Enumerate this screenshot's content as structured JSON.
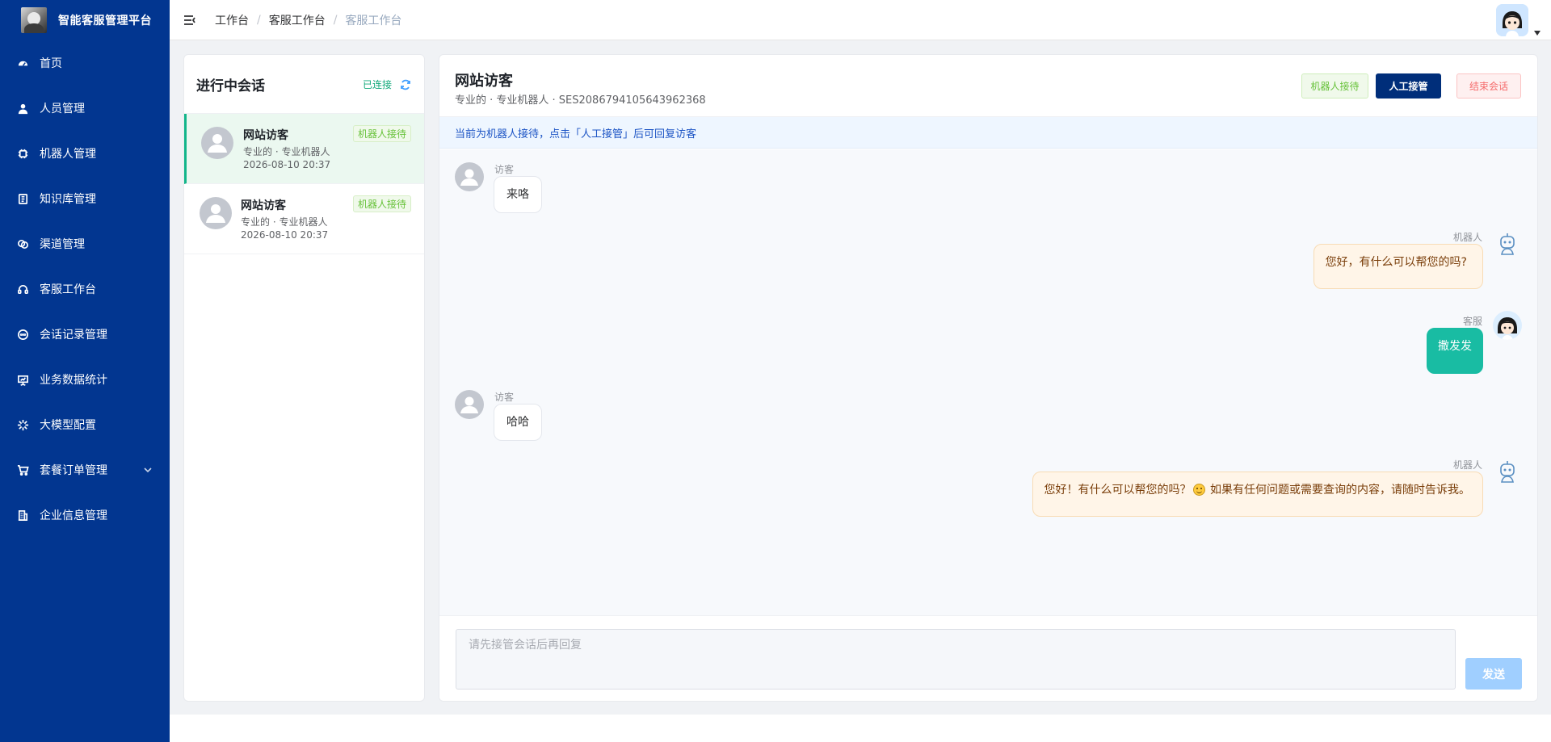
{
  "brand": {
    "title": "智能客服管理平台"
  },
  "sidebar": {
    "items": [
      {
        "label": "首页",
        "icon": "dashboard-icon"
      },
      {
        "label": "人员管理",
        "icon": "user-icon"
      },
      {
        "label": "机器人管理",
        "icon": "chip-icon"
      },
      {
        "label": "知识库管理",
        "icon": "book-icon"
      },
      {
        "label": "渠道管理",
        "icon": "link-icon"
      },
      {
        "label": "客服工作台",
        "icon": "headset-icon"
      },
      {
        "label": "会话记录管理",
        "icon": "chat-bubble-icon"
      },
      {
        "label": "业务数据统计",
        "icon": "presentation-chart-icon"
      },
      {
        "label": "大模型配置",
        "icon": "sparkle-icon"
      },
      {
        "label": "套餐订单管理",
        "icon": "cart-icon",
        "has_children": true
      },
      {
        "label": "企业信息管理",
        "icon": "building-icon"
      }
    ]
  },
  "header": {
    "breadcrumb": [
      "工作台",
      "客服工作台",
      "客服工作台"
    ]
  },
  "sessions": {
    "title": "进行中会话",
    "status": "已连接",
    "items": [
      {
        "name": "网站访客",
        "meta": "专业的 · 专业机器人",
        "time": "2026-08-10 20:37",
        "tag": "机器人接待",
        "active": true
      },
      {
        "name": "网站访客",
        "meta": "专业的 · 专业机器人",
        "time": "2026-08-10 20:37",
        "tag": "机器人接待",
        "active": false
      }
    ]
  },
  "chat": {
    "title": "网站访客",
    "subtitle": "专业的 · 专业机器人 · SES2086794105643962368",
    "buttons": {
      "robot": "机器人接待",
      "takeover": "人工接管",
      "end": "结束会话"
    },
    "notice": "当前为机器人接待，点击「人工接管」后可回复访客",
    "messages": [
      {
        "role": "visitor",
        "label": "访客",
        "text": "来咯"
      },
      {
        "role": "robot",
        "label": "机器人",
        "text": "您好，有什么可以帮您的吗?"
      },
      {
        "role": "agent",
        "label": "客服",
        "text": "撒发发"
      },
      {
        "role": "visitor",
        "label": "访客",
        "text": "哈哈"
      },
      {
        "role": "robot",
        "label": "机器人",
        "text_before": "您好！有什么可以帮您的吗？",
        "text_after": "如果有任何问题或需要查询的内容，请随时告诉我。"
      }
    ],
    "input": {
      "placeholder": "请先接管会话后再回复"
    },
    "send_label": "发送"
  },
  "colors": {
    "sidebar_bg": "#023690",
    "accent_green": "#13b58a",
    "agent_bubble": "#19bca3",
    "takeover_button": "#002e7a"
  }
}
